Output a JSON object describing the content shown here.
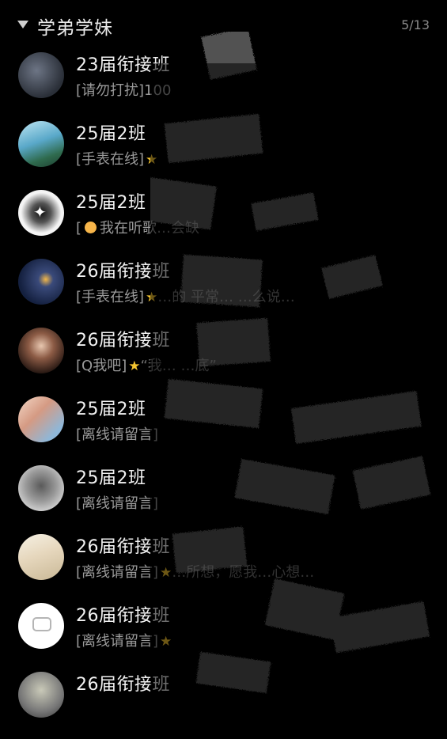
{
  "group": {
    "title": "学弟学妹",
    "count": "5/13"
  },
  "contacts": [
    {
      "name": "23届衔接班",
      "status_prefix": "[请勿打扰]100",
      "status_tail": ""
    },
    {
      "name": "25届2班",
      "status_prefix": "[手表在线]",
      "status_tail": ""
    },
    {
      "name": "25届2班",
      "status_prefix": "[",
      "status_mid": "我在听歌",
      "status_tail": "…会缺"
    },
    {
      "name": "26届衔接班",
      "status_prefix": "[手表在线]",
      "status_tail": "…的 平常…  …么说…"
    },
    {
      "name": "26届衔接班",
      "status_prefix": "[Q我吧]",
      "status_tail": "“我…  …底”"
    },
    {
      "name": "25届2班",
      "status_prefix": "[离线请留言]",
      "status_tail": ""
    },
    {
      "name": "25届2班",
      "status_prefix": "[离线请留言]",
      "status_tail": ""
    },
    {
      "name": "26届衔接班",
      "status_prefix": "[离线请留言]",
      "status_tail": "…所想，愿我…心想…"
    },
    {
      "name": "26届衔接班",
      "status_prefix": "[离线请留言]",
      "status_tail": ""
    },
    {
      "name": "26届衔接班",
      "status_prefix": "",
      "status_tail": ""
    }
  ],
  "avatar_icons": [
    "portrait-photo",
    "lake-scene-photo",
    "butterfly-icon",
    "night-portrait-photo",
    "girl-portrait-photo",
    "couple-photo",
    "hooded-figure-photo",
    "blurred-portrait-photo",
    "chat-bubble-icon",
    "portrait-photo"
  ],
  "colors": {
    "background": "#000000",
    "star": "#f4c430",
    "status_text": "#9a9a9a"
  }
}
